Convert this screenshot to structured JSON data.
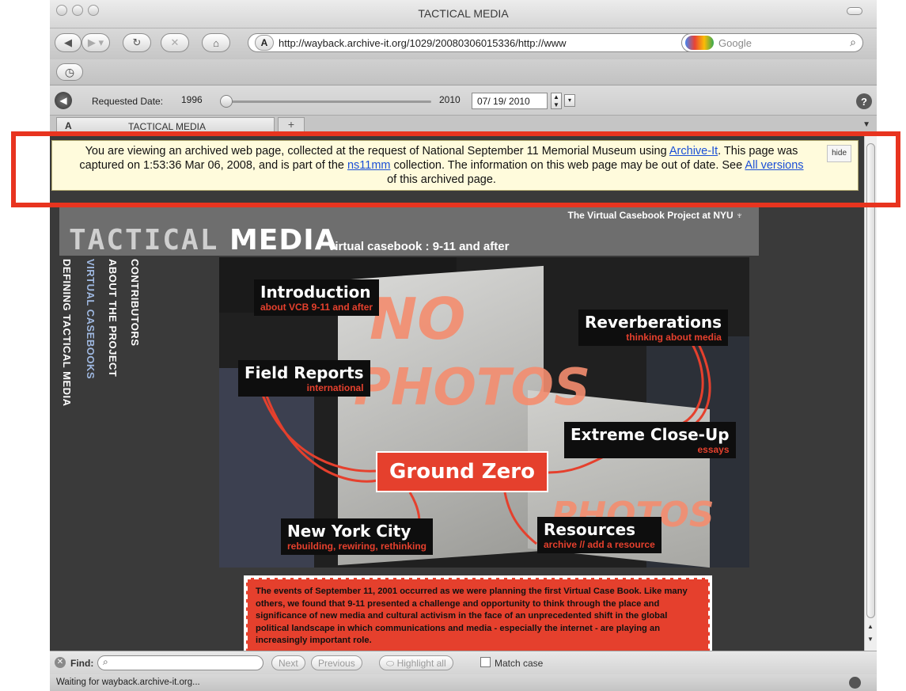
{
  "window": {
    "title": "TACTICAL MEDIA"
  },
  "nav": {
    "url": "http://wayback.archive-it.org/1029/20080306015336/http://www",
    "search_placeholder": "Google"
  },
  "date_bar": {
    "label": "Requested Date:",
    "start_year": "1996",
    "end_year": "2010",
    "date_value": "07/ 19/ 2010"
  },
  "tab": {
    "title": "TACTICAL MEDIA",
    "new_tab": "+"
  },
  "banner": {
    "text_1": "You are viewing an archived web page, collected at the request of National September 11 Memorial Museum using ",
    "link_archive_it": "Archive-It",
    "text_2": ". This page was captured on 1:53:36 Mar 06, 2008, and is part of the ",
    "link_collection": "ns11mm",
    "text_3": " collection. The information on this web page may be out of date. See ",
    "link_versions": "All versions",
    "text_4": " of this archived page.",
    "hide": "hide"
  },
  "site": {
    "logo_part_1": "TACTICAL",
    "logo_part_2": "MEDIA",
    "tagline": "virtual casebook : 9-11 and after",
    "project": "The Virtual Casebook Project at NYU",
    "vnav": [
      "DEFINING TACTICAL MEDIA",
      "VIRTUAL CASEBOOKS",
      "ABOUT THE PROJECT",
      "CONTRIBUTORS"
    ]
  },
  "collage": {
    "labels": [
      {
        "title": "Introduction",
        "sub": "about VCB 9-11 and after"
      },
      {
        "title": "Reverberations",
        "sub": "thinking about media"
      },
      {
        "title": "Field Reports",
        "sub": "international"
      },
      {
        "title": "Extreme Close-Up",
        "sub": "essays"
      },
      {
        "title": "New York City",
        "sub": "rebuilding, rewiring, rethinking"
      },
      {
        "title": "Resources",
        "sub": "archive // add a resource"
      }
    ],
    "center": "Ground Zero",
    "graffiti_1": "NO",
    "graffiti_2": "PHOTOS",
    "graffiti_3": "PHOTOS"
  },
  "intro_text": "The events of September 11, 2001 occurred as we were planning the first Virtual Case Book. Like many others, we found that 9-11 presented a challenge and opportunity to think through the place and significance of new media and cultural activism in the face of an unprecedented shift in the global political landscape in which communications and media - especially the internet - are playing an increasingly important role.",
  "findbar": {
    "label": "Find:",
    "next": "Next",
    "previous": "Previous",
    "highlight": "Highlight all",
    "match_case": "Match case"
  },
  "status": {
    "text": "Waiting for wayback.archive-it.org..."
  },
  "colors": {
    "highlight": "#e8341f",
    "accent_red": "#e5402d",
    "link": "#1a4fd6"
  }
}
